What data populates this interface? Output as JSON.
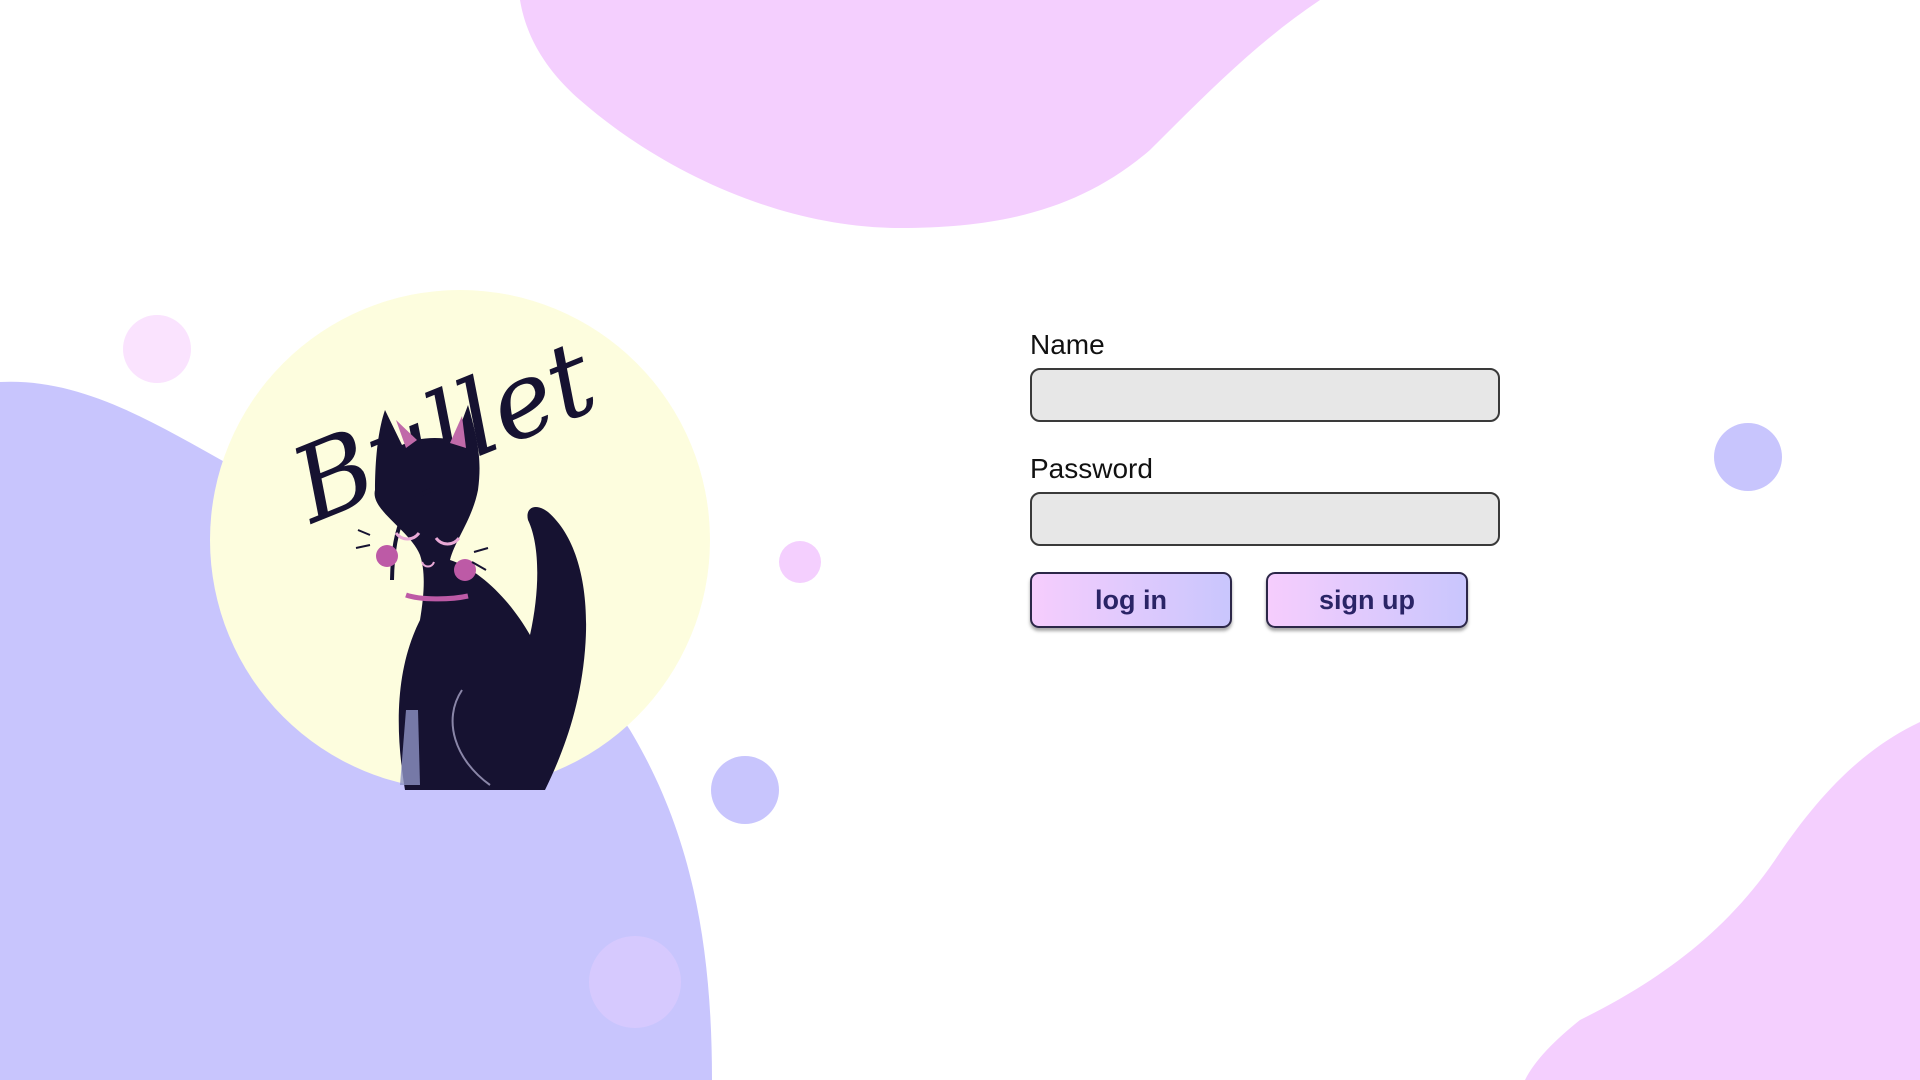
{
  "logo": {
    "text": "Bullet"
  },
  "form": {
    "name_label": "Name",
    "name_value": "",
    "password_label": "Password",
    "password_value": ""
  },
  "buttons": {
    "login_label": "log in",
    "signup_label": "sign up"
  },
  "colors": {
    "blob_pink": "#f4cffe",
    "blob_lavender": "#c8c5fd",
    "logo_bg": "#fdfdde",
    "cat": "#161231",
    "cheek": "#bd5aa6",
    "input_bg": "#e7e7e7",
    "button_text": "#2a2466"
  }
}
